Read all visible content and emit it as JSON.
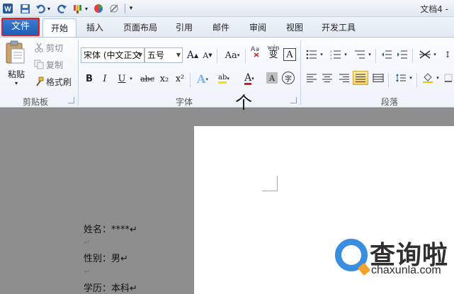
{
  "window": {
    "doc_title": "文档4 -"
  },
  "quick_access": {
    "customize": "▾"
  },
  "tabs": [
    {
      "label": "文件"
    },
    {
      "label": "开始"
    },
    {
      "label": "插入"
    },
    {
      "label": "页面布局"
    },
    {
      "label": "引用"
    },
    {
      "label": "邮件"
    },
    {
      "label": "审阅"
    },
    {
      "label": "视图"
    },
    {
      "label": "开发工具"
    }
  ],
  "clipboard": {
    "paste_label": "粘贴",
    "cut_label": "剪切",
    "copy_label": "复制",
    "format_painter_label": "格式刷",
    "group_label": "剪贴板"
  },
  "font": {
    "font_name": "宋体 (中文正文",
    "font_size": "五号",
    "grow": "A",
    "shrink": "A",
    "change_case": "Aa",
    "pinyin": "wén",
    "pinyin_char": "文",
    "phonetic": "变",
    "border_char": "A",
    "bold": "B",
    "italic": "I",
    "underline": "U",
    "strike": "abc",
    "subscript": "x₂",
    "superscript": "x²",
    "text_effect": "A",
    "highlight": "ab",
    "font_color": "A",
    "char_shading": "A",
    "enclose": "字",
    "group_label": "字体"
  },
  "paragraph": {
    "group_label": "段落"
  },
  "document": {
    "heading": "个",
    "lines": [
      {
        "text": "姓名：****↵"
      },
      {
        "text": "↵"
      },
      {
        "text": "性别：男↵"
      },
      {
        "text": "↵"
      },
      {
        "text": "学历：本科↵"
      }
    ]
  },
  "watermark": {
    "brand": "查询啦",
    "domain": "chaxunla.com"
  },
  "colors": {
    "file_tab": "#2a6cc4",
    "highlight_frame": "#e02020",
    "accent": "#3b8de0"
  }
}
